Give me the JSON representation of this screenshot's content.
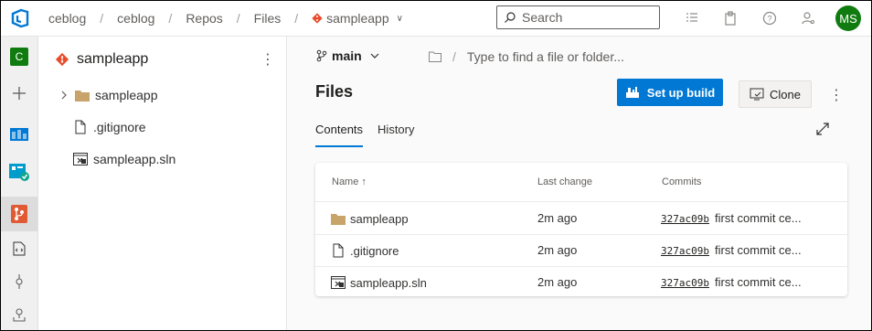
{
  "breadcrumb": {
    "items": [
      "ceblog",
      "ceblog",
      "Repos",
      "Files"
    ],
    "repo": "sampleapp"
  },
  "search": {
    "placeholder": "Search"
  },
  "user": {
    "initials": "MS",
    "avatar_color": "#107c10"
  },
  "rail": {
    "project_letter": "C"
  },
  "tree": {
    "title": "sampleapp",
    "items": [
      {
        "label": "sampleapp",
        "icon": "folder-icon",
        "expandable": true
      },
      {
        "label": ".gitignore",
        "icon": "file-icon"
      },
      {
        "label": "sampleapp.sln",
        "icon": "solution-file-icon"
      }
    ]
  },
  "main": {
    "branch": "main",
    "path_placeholder": "Type to find a file or folder...",
    "heading": "Files",
    "setup_build": "Set up build",
    "clone": "Clone",
    "tabs": [
      "Contents",
      "History"
    ],
    "columns": {
      "name": "Name",
      "last_change": "Last change",
      "commits": "Commits"
    },
    "rows": [
      {
        "name": "sampleapp",
        "icon": "folder-icon",
        "last_change": "2m ago",
        "hash": "327ac09b",
        "message": "first commit ce..."
      },
      {
        "name": ".gitignore",
        "icon": "file-icon",
        "last_change": "2m ago",
        "hash": "327ac09b",
        "message": "first commit ce..."
      },
      {
        "name": "sampleapp.sln",
        "icon": "solution-file-icon",
        "last_change": "2m ago",
        "hash": "327ac09b",
        "message": "first commit ce..."
      }
    ]
  },
  "colors": {
    "accent": "#0078d4",
    "repo_icon": "#e74c2c",
    "folder": "#c8a36a"
  }
}
